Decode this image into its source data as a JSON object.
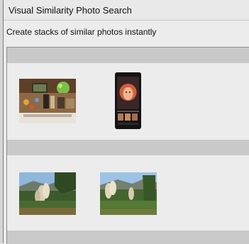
{
  "window": {
    "title": "Visual Similarity Photo Search",
    "subtitle": "Create stacks of similar photos instantly"
  },
  "groups": [
    {
      "photos": [
        {
          "name": "party-room-photo"
        },
        {
          "name": "phone-portrait-photo"
        }
      ]
    },
    {
      "photos": [
        {
          "name": "pampas-grass-photo-1"
        },
        {
          "name": "pampas-grass-photo-2"
        }
      ]
    }
  ]
}
